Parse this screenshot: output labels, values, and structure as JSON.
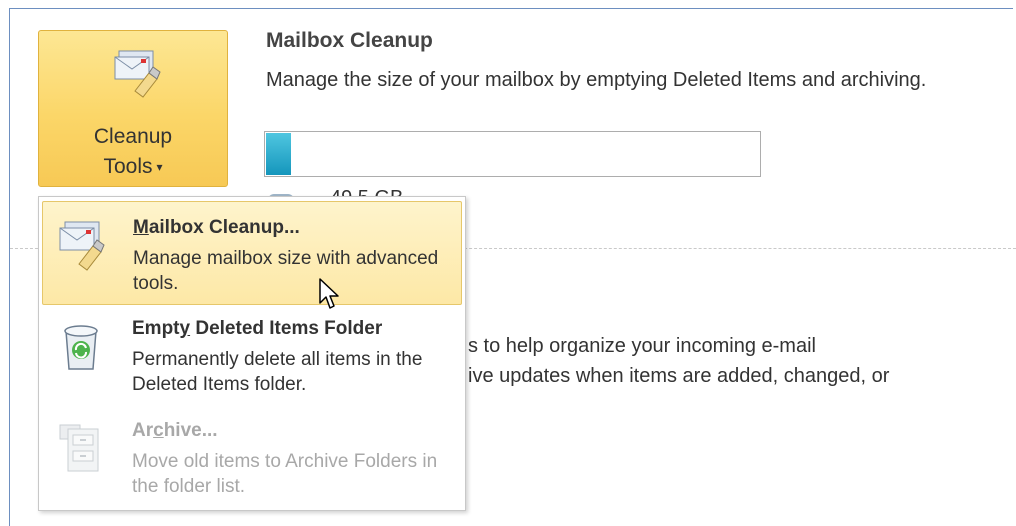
{
  "ribbon": {
    "cleanup_tools_line1": "Cleanup",
    "cleanup_tools_line2": "Tools",
    "cleanup_tools_arrow": "▾"
  },
  "info": {
    "title": "Mailbox Cleanup",
    "description": "Manage the size of your mailbox by emptying Deleted Items and archiving.",
    "usage_text": "49.5 GB",
    "usage_fraction": 0.05,
    "rules_line1": "s to help organize your incoming e-mail",
    "rules_line2": "ive updates when items are added, changed, or"
  },
  "menu": {
    "items": [
      {
        "title": "Mailbox Cleanup...",
        "underline_char": "M",
        "rest": "ailbox Cleanup...",
        "sub": "Manage mailbox size with advanced tools.",
        "state": "hover"
      },
      {
        "title": "Empty Deleted Items Folder",
        "pre": "Empt",
        "underline_char": "y",
        "rest": " Deleted Items Folder",
        "sub": "Permanently delete all items in the Deleted Items folder.",
        "state": "normal"
      },
      {
        "title": "Archive...",
        "pre": "Ar",
        "underline_char": "c",
        "rest": "hive...",
        "sub": "Move old items to Archive Folders in the folder list.",
        "state": "disabled"
      }
    ]
  },
  "colors": {
    "button_gradient_top": "#fde794",
    "button_gradient_bottom": "#f7c955",
    "progress_fill": "#1596bc",
    "disabled_text": "#a8a8a8"
  }
}
